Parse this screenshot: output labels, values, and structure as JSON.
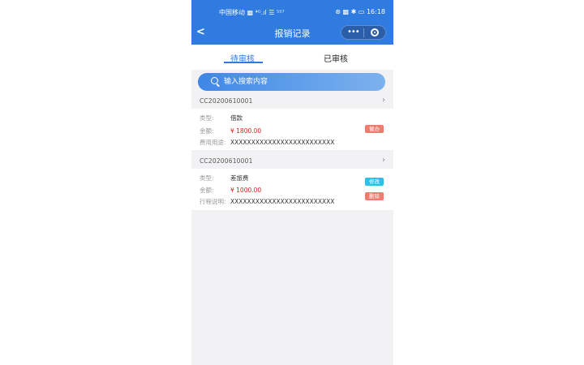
{
  "status_bar": {
    "carrier": "中国移动 ▩ ⁴ᴳ.ıl ☰ ⁵⁵⁷",
    "right": "⊛ ▩ ✱ ▭ 16:18"
  },
  "nav": {
    "back_label": "<",
    "title": "报销记录",
    "more_label": "•••"
  },
  "tabs": [
    {
      "label": "待审核",
      "active": true
    },
    {
      "label": "已审核",
      "active": false
    }
  ],
  "search": {
    "placeholder": "输入搜索内容"
  },
  "records": [
    {
      "code": "CC20200610001",
      "fields": [
        {
          "label": "类型:",
          "value": "借款"
        },
        {
          "label": "金额:",
          "value": "¥ 1800.00"
        },
        {
          "label": "费用用途:",
          "value": "XXXXXXXXXXXXXXXXXXXXXXXXX"
        }
      ],
      "actions": [
        "催办"
      ]
    },
    {
      "code": "CC20200610001",
      "fields": [
        {
          "label": "类型:",
          "value": "差旅费"
        },
        {
          "label": "金额:",
          "value": "¥ 1000.00"
        },
        {
          "label": "行程说明:",
          "value": "XXXXXXXXXXXXXXXXXXXXXXXXX"
        }
      ],
      "actions": [
        "修改",
        "删除"
      ]
    }
  ],
  "colors": {
    "primary": "#2f7be0",
    "money": "#e02020",
    "urge": "#f07a6e",
    "edit": "#2ac2e8"
  }
}
